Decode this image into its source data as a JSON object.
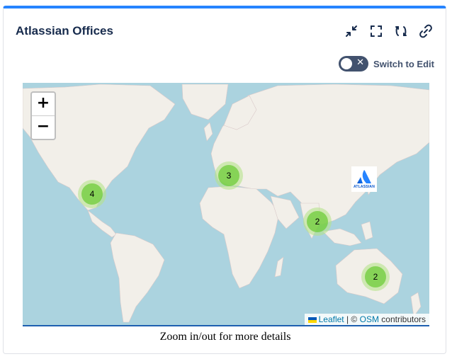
{
  "widget": {
    "title": "Atlassian Offices",
    "toolbar": [
      {
        "icon": "collapse-icon"
      },
      {
        "icon": "fullscreen-icon"
      },
      {
        "icon": "refresh-icon"
      },
      {
        "icon": "link-icon"
      }
    ],
    "toggle": {
      "label": "Switch to Edit",
      "state": "off",
      "icon": "close-icon"
    }
  },
  "map": {
    "zoom_in_label": "+",
    "zoom_out_label": "−",
    "clusters": [
      {
        "count": "4",
        "region": "north-america"
      },
      {
        "count": "3",
        "region": "europe"
      },
      {
        "count": "2",
        "region": "southeast-asia"
      },
      {
        "count": "2",
        "region": "australia"
      }
    ],
    "marker": {
      "brand": "ATLASSIAN",
      "region": "japan"
    },
    "attribution": {
      "leaflet": "Leaflet",
      "separator": "| ©",
      "osm": "OSM",
      "contributors": "contributors"
    },
    "colors": {
      "water": "#abd3df",
      "land": "#f2efe9",
      "cluster": "#6ecc39"
    }
  },
  "caption": "Zoom in/out for more details"
}
